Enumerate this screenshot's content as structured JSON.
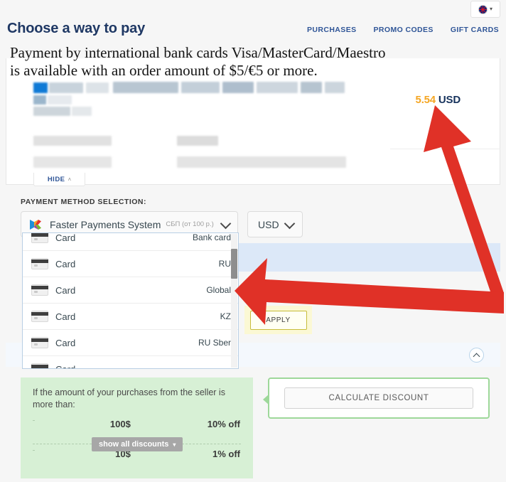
{
  "language_switcher": {
    "flag": "uk-flag-icon",
    "chevron": "▾"
  },
  "header": {
    "title": "Choose a way to pay",
    "nav": [
      {
        "label": "PURCHASES"
      },
      {
        "label": "PROMO CODES"
      },
      {
        "label": "GIFT CARDS"
      }
    ]
  },
  "notice": {
    "line1": "Payment by international bank cards Visa/MasterCard/Maestro",
    "line2": "is available with an order amount of $5/€5 or more."
  },
  "order": {
    "price_amount": "5.54",
    "price_currency": "USD"
  },
  "hide_tab": {
    "label": "HIDE",
    "caret": "˄"
  },
  "payment": {
    "section_label": "PAYMENT METHOD SELECTION:",
    "selected_method": "Faster Payments System",
    "selected_method_note": "СБП (от 100 р.)",
    "currency_value": "USD",
    "options": [
      {
        "label": "Card",
        "tag": "Bank card"
      },
      {
        "label": "Card",
        "tag": "RU"
      },
      {
        "label": "Card",
        "tag": "Global"
      },
      {
        "label": "Card",
        "tag": "KZ"
      },
      {
        "label": "Card",
        "tag": "RU Sber"
      },
      {
        "label": "Card",
        "tag": ""
      }
    ]
  },
  "promo": {
    "apply_label": "APPLY"
  },
  "discounts": {
    "intro": "If the amount of your purchases from the seller is more than:",
    "rows": [
      {
        "threshold": "100$",
        "value": "10% off"
      },
      {
        "threshold": "10$",
        "value": "1% off"
      }
    ],
    "show_all_label": "show all discounts",
    "show_all_caret": "▾"
  },
  "calculate": {
    "button_label": "CALCULATE DISCOUNT"
  },
  "colors": {
    "accent_blue": "#2f5597",
    "price_orange": "#f5a623",
    "discount_green": "#d7f0d5",
    "callout_border_green": "#9ed89a",
    "annotation_red": "#e03127",
    "highlight_blue": "#dce8f8",
    "apply_highlight": "#fbf8d4"
  }
}
